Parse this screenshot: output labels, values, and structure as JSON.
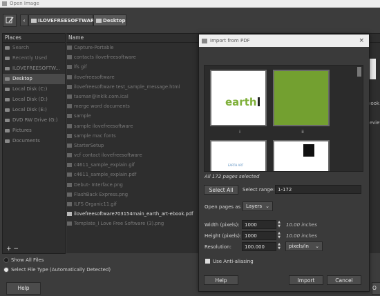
{
  "window": {
    "title": "Open Image"
  },
  "breadcrumb": {
    "parent": "ILOVEFREESOFTWARE",
    "current": "Desktop"
  },
  "places": {
    "header": "Places",
    "items": [
      {
        "label": "Search",
        "selected": false
      },
      {
        "label": "Recently Used",
        "selected": false
      },
      {
        "label": "ILOVEFREESOFTW...",
        "selected": false
      },
      {
        "label": "Desktop",
        "selected": true
      },
      {
        "label": "Local Disk (C:)",
        "selected": false
      },
      {
        "label": "Local Disk (D:)",
        "selected": false
      },
      {
        "label": "Local Disk (E:)",
        "selected": false
      },
      {
        "label": "DVD RW Drive (G:)",
        "selected": false
      },
      {
        "label": "Pictures",
        "selected": false
      },
      {
        "label": "Documents",
        "selected": false
      }
    ],
    "add_remove": "+ −"
  },
  "files": {
    "header": "Name",
    "items": [
      {
        "name": "Capture-Portable",
        "highlight": false
      },
      {
        "name": "contacts ilovefreesoftware",
        "highlight": false
      },
      {
        "name": "lfs gif",
        "highlight": false
      },
      {
        "name": "ilovefreesoftware",
        "highlight": false
      },
      {
        "name": "ilovefreesoftware test_sample_message.html",
        "highlight": false
      },
      {
        "name": "tasman@inklk.com.ical",
        "highlight": false
      },
      {
        "name": "merge word documents",
        "highlight": false
      },
      {
        "name": "sample",
        "highlight": false
      },
      {
        "name": "sample ilovefreesoftware",
        "highlight": false
      },
      {
        "name": "sample mac fonts",
        "highlight": false
      },
      {
        "name": "StarterSetup",
        "highlight": false
      },
      {
        "name": "vcf contact ilovefreesoftware",
        "highlight": false
      },
      {
        "name": "c4611_sample_explain.gif",
        "highlight": false
      },
      {
        "name": "c4611_sample_explain.pdf",
        "highlight": false
      },
      {
        "name": "Debut- Interface.png",
        "highlight": false
      },
      {
        "name": "FlashBack Express.png",
        "highlight": false
      },
      {
        "name": "ILFS Organic11.gif",
        "highlight": false
      },
      {
        "name": "ilovefreesoftware703154main_earth_art-ebook.pdf",
        "highlight": true
      },
      {
        "name": "Template_I Love Free Software (3).png",
        "highlight": false
      }
    ],
    "preview_text_1": "book.p",
    "preview_text_2": "review"
  },
  "bottom": {
    "show_all_files": "Show All Files",
    "select_file_type": "Select File Type (Automatically Detected)",
    "help_label": "Help",
    "edge_button": "O"
  },
  "dialog": {
    "title": "Import from PDF",
    "thumbs": [
      {
        "label": "i",
        "kind": "earth-cover"
      },
      {
        "label": "ii",
        "kind": "green"
      },
      {
        "label": "",
        "kind": "earth-art"
      },
      {
        "label": "",
        "kind": "black-square"
      }
    ],
    "thumb_text": {
      "earth_a": "earth",
      "earth_b": "",
      "earth_art": "EARTH ART"
    },
    "selection_info": "All 172 pages selected",
    "select_all_label": "Select All",
    "select_range_label": "Select range:",
    "select_range_value": "1-172",
    "open_pages_as_label": "Open pages as",
    "open_pages_as_value": "Layers",
    "width_label": "Width (pixels):",
    "width_value": "1000",
    "width_unit": "10.00 inches",
    "height_label": "Height (pixels):",
    "height_value": "1000",
    "height_unit": "10.00 inches",
    "resolution_label": "Resolution:",
    "resolution_value": "100.000",
    "resolution_unit": "pixels/in",
    "antialias_label": "Use Anti-aliasing",
    "help_label": "Help",
    "import_label": "Import",
    "cancel_label": "Cancel",
    "close_glyph": "×"
  }
}
